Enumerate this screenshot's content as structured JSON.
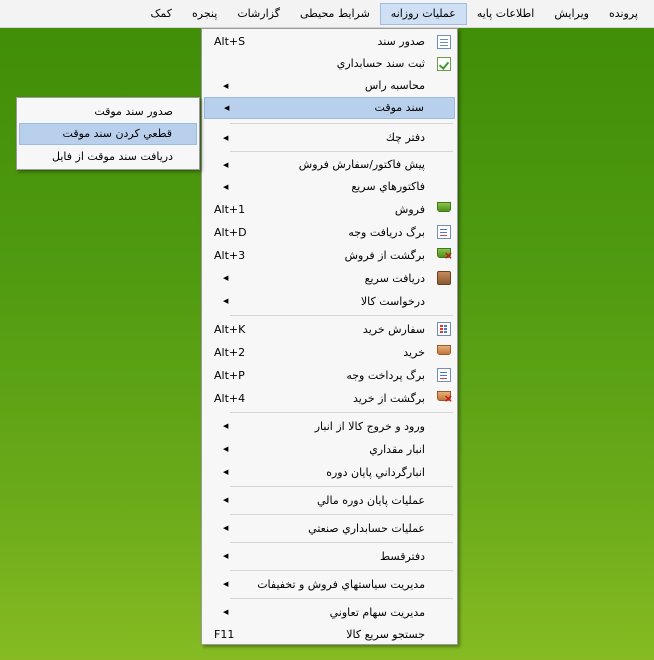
{
  "menubar": {
    "items": [
      "پرونده",
      "ویرایش",
      "اطلاعات پایه",
      "عملیات روزانه",
      "شرایط محیطی",
      "گزارشات",
      "پنجره",
      "کمک"
    ]
  },
  "main_menu": {
    "items": [
      {
        "label": "صدور سند",
        "shortcut": "Alt+S",
        "icon": "document-icon"
      },
      {
        "label": "ثبت سند حسابداري",
        "icon": "document-check-icon"
      },
      {
        "label": "محاسبه راس",
        "submenu": true
      },
      {
        "label": "سند موقت",
        "submenu": true,
        "highlighted": true
      },
      {
        "label": "دفتر چك",
        "submenu": true
      },
      {
        "label": "پيش فاكتور/سفارش فروش",
        "submenu": true
      },
      {
        "label": "فاكتورهاي سريع",
        "submenu": true
      },
      {
        "label": "فروش",
        "shortcut": "Alt+1",
        "icon": "green-basket-icon"
      },
      {
        "label": "برگ دريافت وجه",
        "shortcut": "Alt+D",
        "icon": "receipt-icon"
      },
      {
        "label": "برگشت از فروش",
        "shortcut": "Alt+3",
        "icon": "green-basket-return-icon"
      },
      {
        "label": "دريافت سريع",
        "submenu": true,
        "icon": "calculator-icon"
      },
      {
        "label": "درخواست کالا",
        "submenu": true
      },
      {
        "label": "سفارش خريد",
        "shortcut": "Alt+K",
        "icon": "checklist-icon"
      },
      {
        "label": "خريد",
        "shortcut": "Alt+2",
        "icon": "brown-basket-icon"
      },
      {
        "label": "برگ پرداخت وجه",
        "shortcut": "Alt+P",
        "icon": "payment-icon"
      },
      {
        "label": "برگشت از خريد",
        "shortcut": "Alt+4",
        "icon": "brown-basket-return-icon"
      },
      {
        "label": "ورود و خروج کالا از انبار",
        "submenu": true
      },
      {
        "label": "انبار مقداري",
        "submenu": true
      },
      {
        "label": "انبارگرداني پايان دوره",
        "submenu": true
      },
      {
        "label": "عمليات پايان دوره مالي",
        "submenu": true
      },
      {
        "label": "عمليات حسابداري صنعتي",
        "submenu": true
      },
      {
        "label": "دفترقسط",
        "submenu": true
      },
      {
        "label": "مديريت سياستهاي فروش و تخفيفات",
        "submenu": true
      },
      {
        "label": "مديريت سهام تعاوني",
        "submenu": true
      },
      {
        "label": "جستجو سريع کالا",
        "shortcut": "F11"
      }
    ]
  },
  "sub_menu": {
    "items": [
      {
        "label": "صدور سند موقت"
      },
      {
        "label": "قطعي كردن سند موقت",
        "highlighted": true
      },
      {
        "label": "دريافت سند موقت از فايل"
      }
    ]
  },
  "colors": {
    "highlight": "#b8d0ec",
    "menu_background": "#f7f7f7",
    "desktop_green": "#4f9a10"
  }
}
